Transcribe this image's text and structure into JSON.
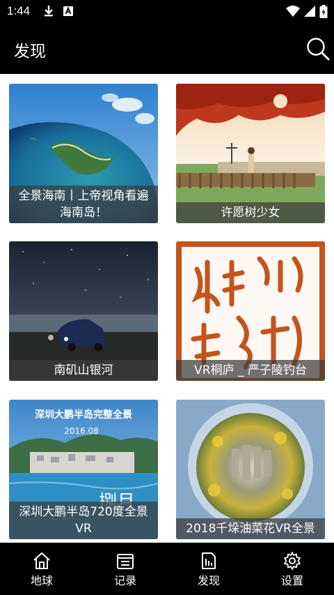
{
  "status": {
    "time": "1:44"
  },
  "header": {
    "title": "发现"
  },
  "cards": [
    {
      "caption": "全景海南丨上帝视角看遍海南岛！"
    },
    {
      "caption": "许愿树少女"
    },
    {
      "caption": "南矶山银河"
    },
    {
      "caption": "VR桐庐 _ 严子陵钓台"
    },
    {
      "caption": "深圳大鹏半岛720度全景VR",
      "overlay_title": "深圳大鹏半岛完整全景",
      "overlay_date": "2016.08",
      "overlay_sign": "捌月"
    },
    {
      "caption": "2018千垛油菜花VR全景"
    }
  ],
  "nav": [
    {
      "label": "地球",
      "icon": "home-icon"
    },
    {
      "label": "记录",
      "icon": "list-icon"
    },
    {
      "label": "发现",
      "icon": "document-icon"
    },
    {
      "label": "设置",
      "icon": "gear-icon"
    }
  ],
  "colors": {
    "bar": "#000000",
    "caption_bg": "#3c3c3c",
    "seal_red": "#c4531c"
  }
}
